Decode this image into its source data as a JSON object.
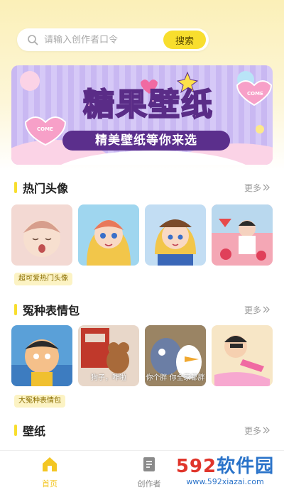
{
  "search": {
    "placeholder": "请输入创作者口令",
    "button_label": "搜索"
  },
  "banner": {
    "title": "糖果壁纸",
    "subtitle": "精美壁纸等你来选",
    "badge_text": "COME"
  },
  "sections": [
    {
      "title": "热门头像",
      "more_label": "更多",
      "tag": "超可爱热门头像",
      "items": [
        {
          "caption": ""
        },
        {
          "caption": ""
        },
        {
          "caption": ""
        },
        {
          "caption": ""
        }
      ]
    },
    {
      "title": "冤种表情包",
      "more_label": "更多",
      "tag": "大冤种表情包",
      "items": [
        {
          "caption": ""
        },
        {
          "caption": "狗子，咋啦"
        },
        {
          "caption": "你个胖 你全家都胖"
        },
        {
          "caption": ""
        }
      ]
    },
    {
      "title": "壁纸",
      "more_label": "更多"
    }
  ],
  "tabbar": {
    "items": [
      {
        "label": "首页",
        "icon": "home-icon",
        "active": true
      },
      {
        "label": "创作者",
        "icon": "document-icon",
        "active": false
      }
    ]
  },
  "watermark": {
    "brand_red": "592",
    "brand_blue": "软件园",
    "url": "www.592xiazai.com"
  },
  "colors": {
    "accent": "#f8de2e",
    "active_tab": "#f3c623",
    "banner_purple": "#5b2f8c"
  }
}
